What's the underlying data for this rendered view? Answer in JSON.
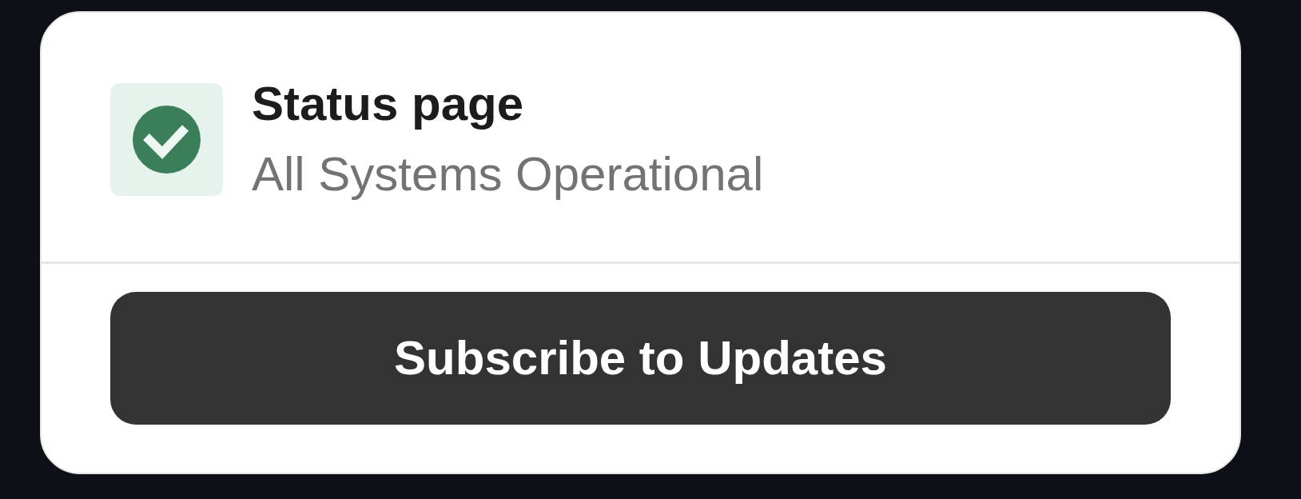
{
  "title": "Status page",
  "status": "All Systems Operational",
  "subscribe_button": "Subscribe to Updates"
}
